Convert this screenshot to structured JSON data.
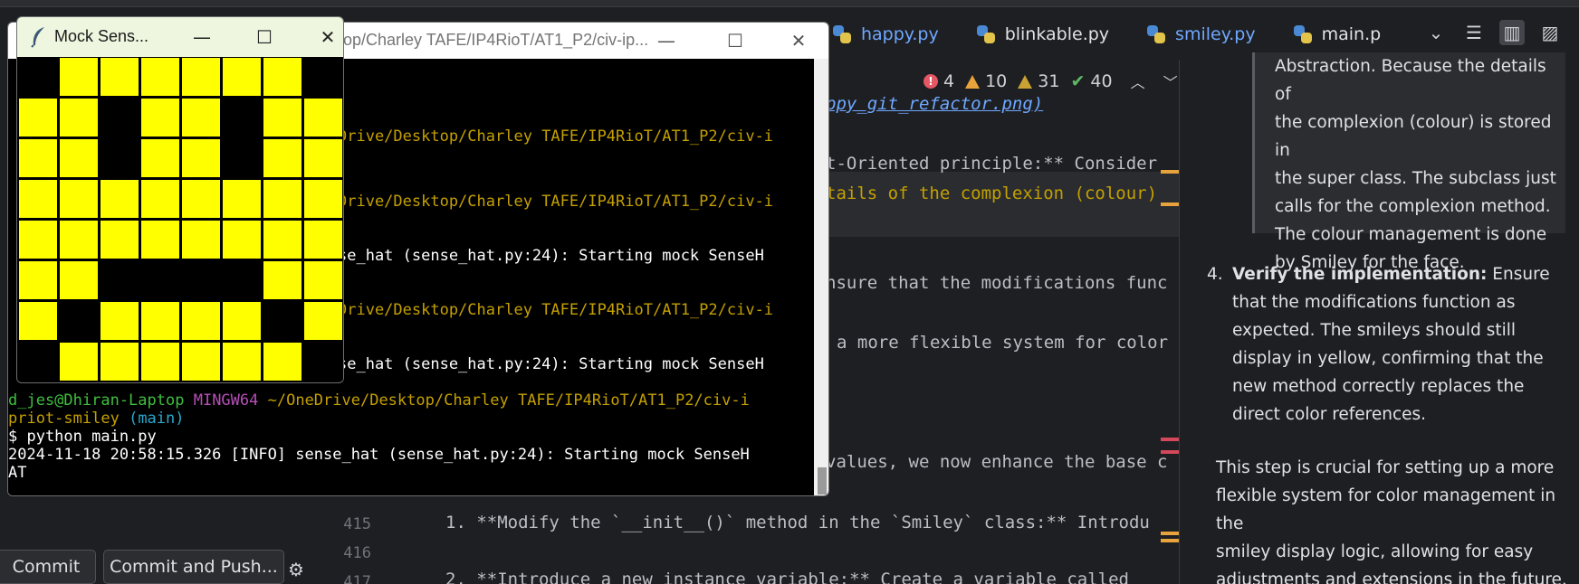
{
  "ide": {
    "tabs": [
      {
        "label": "happy.py",
        "style": "blue",
        "icon": "python-icon"
      },
      {
        "label": "blinkable.py",
        "style": "normal",
        "icon": "python-icon"
      },
      {
        "label": "smiley.py",
        "style": "blue",
        "icon": "python-icon"
      },
      {
        "label": "main.p",
        "style": "normal",
        "icon": "python-icon"
      }
    ],
    "inspections": {
      "errors": "4",
      "warnings": "10",
      "weak_warnings": "31",
      "ok": "40"
    },
    "code_lines": [
      {
        "text": "ppy_git_refactor.png)"
      },
      {
        "text": "t-Oriented principle:** Consider"
      },
      {
        "text": "tails of the complexion (colour)"
      },
      {
        "text": "nsure that the modifications func"
      },
      {
        "text": "a more flexible system for color"
      },
      {
        "text": "values, we now enhance the base c"
      },
      {
        "text": "1. **Modify the `__init__()` method in the `Smiley` class:** Introdu"
      },
      {
        "text": "2. **Introduce a new instance variable:** Create a variable called"
      }
    ],
    "line_numbers": [
      "415",
      "416",
      "417"
    ]
  },
  "right_panel": {
    "quote_lines": [
      "Abstraction. Because the details of",
      "the complexion (colour) is stored in",
      "the super class. The subclass just",
      "calls for the complexion method.",
      "The colour management is done",
      "by Smiley for the face."
    ],
    "step4_number": "4.",
    "step4_bold": "Verify the implementation:",
    "step4_lines": [
      " Ensure",
      "that the modifications function as",
      "expected. The smileys should still",
      "display in yellow, confirming that the",
      "new method correctly replaces the",
      "direct color references."
    ],
    "closing_lines": [
      "This step is crucial for setting up a more",
      "flexible system for color management in the",
      "smiley display logic, allowing for easy",
      "adjustments and extensions in the future."
    ]
  },
  "bottom": {
    "commit_label": "Commit",
    "commit_push_label": "Commit and Push..."
  },
  "terminal": {
    "title": "op/Charley TAFE/IP4RioT/AT1_P2/civ-ip...",
    "lines": [
      {
        "text": "Drive/Desktop/Charley TAFE/IP4RioT/AT1_P2/civ-i",
        "color": "yellow"
      },
      {
        "text": "Drive/Desktop/Charley TAFE/IP4RioT/AT1_P2/civ-i",
        "color": "yellow"
      },
      {
        "text": "se_hat (sense_hat.py:24): Starting mock SenseH",
        "color": "white"
      },
      {
        "text": "Drive/Desktop/Charley TAFE/IP4RioT/AT1_P2/civ-i",
        "color": "yellow"
      },
      {
        "text": "se_hat (sense_hat.py:24): Starting mock SenseH",
        "color": "white"
      }
    ],
    "left_fragments": [
      "d",
      "p",
      "$",
      "b",
      "d",
      "p",
      "$",
      "2",
      "A",
      "d",
      "p",
      "$",
      "2",
      "A"
    ],
    "prompt_user": "d_jes@Dhiran-Laptop",
    "prompt_env": "MINGW64",
    "prompt_path": "~/OneDrive/Desktop/Charley TAFE/IP4RioT/AT1_P2/civ-i",
    "prompt_repo": "priot-smiley",
    "prompt_branch": "(main)",
    "command": "$ python main.py",
    "log_line": "2024-11-18 20:58:15.326 [INFO] sense_hat (sense_hat.py:24): Starting mock SenseH",
    "log_tail": "AT"
  },
  "sense_hat": {
    "title": "Mock Sens...",
    "on_color": "#ffff00",
    "off_color": "#000000",
    "matrix": [
      [
        0,
        1,
        1,
        1,
        1,
        1,
        1,
        0
      ],
      [
        1,
        1,
        0,
        1,
        1,
        0,
        1,
        1
      ],
      [
        1,
        1,
        0,
        1,
        1,
        0,
        1,
        1
      ],
      [
        1,
        1,
        1,
        1,
        1,
        1,
        1,
        1
      ],
      [
        1,
        1,
        1,
        1,
        1,
        1,
        1,
        1
      ],
      [
        1,
        1,
        0,
        0,
        0,
        0,
        1,
        1
      ],
      [
        1,
        0,
        1,
        1,
        1,
        1,
        0,
        1
      ],
      [
        0,
        1,
        1,
        1,
        1,
        1,
        1,
        0
      ]
    ]
  }
}
